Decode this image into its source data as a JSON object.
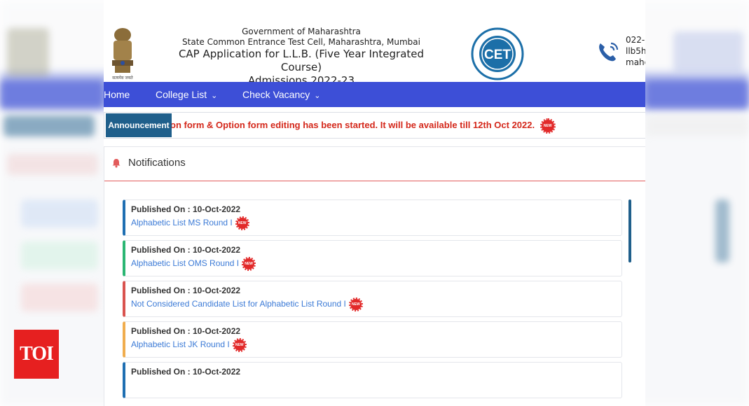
{
  "header": {
    "line1": "Government of Maharashtra",
    "line2": "State Common Entrance Test Cell, Maharashtra, Mumbai",
    "line3": "CAP Application for L.L.B. (Five Year Integrated Course)",
    "line4": "Admissions 2022-23",
    "emblem_caption": "सत्यमेव जयते",
    "cet_logo_text": "CET",
    "contact_lines": [
      "022-(",
      "llb5h",
      "mahc"
    ]
  },
  "nav": {
    "items": [
      {
        "label": "Home"
      },
      {
        "label": "College List",
        "has_dropdown": true
      },
      {
        "label": "Check Vacancy",
        "has_dropdown": true
      }
    ]
  },
  "announcement": {
    "label": "Announcement",
    "text": "on form & Option form editing has been started. It will be available till 12th Oct 2022.",
    "badge": "NEW"
  },
  "notifications": {
    "title": "Notifications",
    "items": [
      {
        "date": "Published On : 10-Oct-2022",
        "link": "Alphabetic List MS Round I",
        "badge": "NEW",
        "accent": "#1f6fb2"
      },
      {
        "date": "Published On : 10-Oct-2022",
        "link": "Alphabetic List OMS Round I",
        "badge": "NEW",
        "accent": "#2bb673"
      },
      {
        "date": "Published On : 10-Oct-2022",
        "link": "Not Considered Candidate List for Alphabetic List Round I",
        "badge": "NEW",
        "accent": "#d9534f"
      },
      {
        "date": "Published On : 10-Oct-2022",
        "link": "Alphabetic List JK Round I",
        "badge": "NEW",
        "accent": "#f0ad4e"
      },
      {
        "date": "Published On : 10-Oct-2022",
        "link": "",
        "badge": "",
        "accent": "#1f6fb2"
      }
    ]
  },
  "watermark": {
    "label": "TOI"
  },
  "colors": {
    "nav_bg": "#3d4fd7",
    "announce_label_bg": "#1f5f8b",
    "announce_text": "#d4281b",
    "link": "#3b7ad6",
    "watermark_bg": "#e62020"
  }
}
